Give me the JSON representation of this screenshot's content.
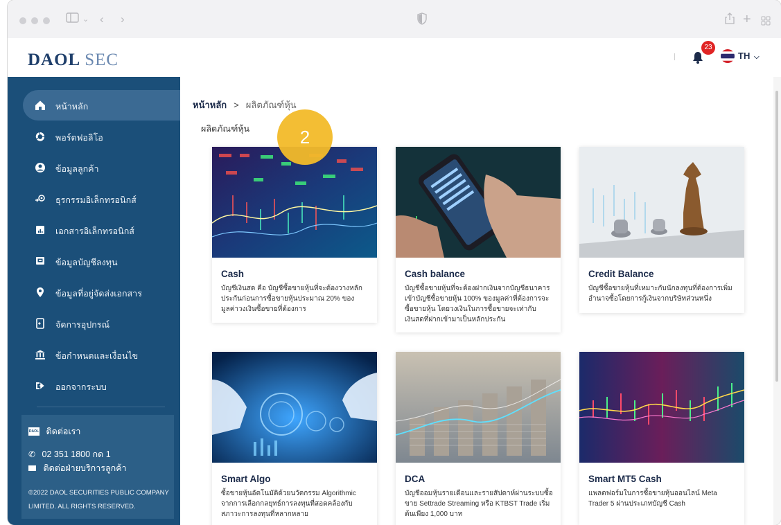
{
  "browser": {
    "back_icon": "chevron-left-icon",
    "forward_icon": "chevron-right-icon",
    "shield_icon": "shield-icon",
    "share_icon": "share-icon",
    "new_tab_icon": "plus-icon",
    "tab_grid_icon": "grid-icon"
  },
  "header": {
    "logo_part1": "DAOL",
    "logo_part2": "SEC",
    "notification_count": "23",
    "language": "TH"
  },
  "sidebar": {
    "items": [
      {
        "label": "หน้าหลัก",
        "icon": "home-icon",
        "active": true
      },
      {
        "label": "พอร์ตฟอลิโอ",
        "icon": "portfolio-icon"
      },
      {
        "label": "ข้อมูลลูกค้า",
        "icon": "user-icon"
      },
      {
        "label": "ธุรกรรมอิเล็กทรอนิกส์",
        "icon": "transaction-icon"
      },
      {
        "label": "เอกสารอิเล็กทรอนิกส์",
        "icon": "document-icon"
      },
      {
        "label": "ข้อมูลบัญชีลงทุน",
        "icon": "account-icon"
      },
      {
        "label": "ข้อมูลที่อยู่จัดส่งเอกสาร",
        "icon": "location-icon"
      },
      {
        "label": "จัดการอุปกรณ์",
        "icon": "device-icon"
      },
      {
        "label": "ข้อกำหนดและเงื่อนไข",
        "icon": "bank-icon"
      },
      {
        "label": "ออกจากระบบ",
        "icon": "logout-icon"
      }
    ],
    "contact": {
      "title": "ติดต่อเรา",
      "phone": "02 351 1800 กด 1",
      "email_label": "ติดต่อฝ่ายบริการลูกค้า",
      "copyright_line1": "©2022 DAOL SECURITIES PUBLIC COMPANY",
      "copyright_line2": "LIMITED. ALL RIGHTS RESERVED."
    }
  },
  "main": {
    "breadcrumb_home": "หน้าหลัก",
    "breadcrumb_sep": ">",
    "breadcrumb_current": "ผลิตภัณฑ์หุ้น",
    "page_title": "ผลิตภัณฑ์หุ้น",
    "step_number": "2",
    "cards": [
      {
        "title": "Cash",
        "desc": "บัญชีเงินสด คือ บัญชีซื้อขายหุ้นที่จะต้องวางหลักประกันก่อนการซื้อขายหุ้นประมาณ 20% ของมูลค่าวงเงินซื้อขายที่ต้องการ"
      },
      {
        "title": "Cash balance",
        "desc": "บัญชีซื้อขายหุ้นที่จะต้องฝากเงินจากบัญชีธนาคารเข้าบัญชีซื้อขายหุ้น 100% ของมูลค่าที่ต้องการจะซื้อขายหุ้น โดยวงเงินในการซื้อขายจะเท่ากับเงินสดที่ฝากเข้ามาเป็นหลักประกัน"
      },
      {
        "title": "Credit Balance",
        "desc": "บัญชีซื้อขายหุ้นที่เหมาะกับนักลงทุนที่ต้องการเพิ่มอำนาจซื้อโดยการกู้เงินจากบริษัทส่วนหนึ่ง"
      },
      {
        "title": "Smart Algo",
        "desc": "ซื้อขายหุ้นอัตโนมัติด้วยนวัตกรรม Algorithmic จากการเลือกกลยุทธ์การลงทุนที่สอดคล้องกับสภาวะการลงทุนที่หลากหลาย"
      },
      {
        "title": "DCA",
        "desc": "บัญชีออมหุ้นรายเดือนและรายสัปดาห์ผ่านระบบซื้อขาย Settrade Streaming หรือ KTBST Trade เริ่มต้นเพียง 1,000 บาท"
      },
      {
        "title": "Smart MT5 Cash",
        "desc": "แพลตฟอร์มในการซื้อขายหุ้นออนไลน์ Meta Trader 5 ผ่านประเภทบัญชี Cash"
      }
    ]
  },
  "colors": {
    "sidebar": "#1b4f79",
    "sidebar_active": "#3b6a93",
    "accent_yellow": "#f3bb2a",
    "brand_navy": "#1f3f6b"
  }
}
